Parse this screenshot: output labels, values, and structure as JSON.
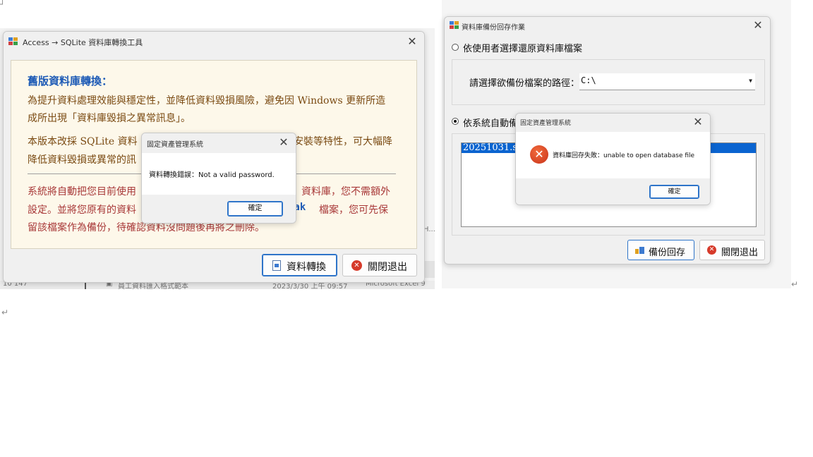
{
  "left_window": {
    "title": "Access → SQLite 資料庫轉換工具",
    "heading": "舊版資料庫轉換：",
    "para1_line1": "為提升資料處理效能與穩定性，並降低資料毀損風險，避免因 Windows 更新所造",
    "para1_line2": "成所出現「資料庫毀損之異常訊息」。",
    "para2_line1_a": "本版本改採 SQLite 資料",
    "para2_line1_b": "安裝等特性，可大幅降",
    "para2_line2": "降低資料毀損或異常的訊",
    "red_line1_a": "系統將自動把您目前使用",
    "red_line1_b": "資料庫，您不需額外",
    "red_line2_a": "設定。並將您原有的資料",
    "red_line2_b": "bak",
    "red_line2_c": "檔案，您可先保",
    "red_line3": "留該檔案作為備份，待確認資料沒問題後再將之刪除。",
    "convert_button": "資料轉換",
    "exit_button": "關閉退出"
  },
  "left_message": {
    "title": "固定資產管理系統",
    "text": "資料轉換錯誤：Not a valid password.",
    "ok": "確定"
  },
  "right_window": {
    "title": "資料庫備份回存作業",
    "radio_user": "依使用者選擇還原資料庫檔案",
    "path_label": "請選擇欲備份檔案的路徑：",
    "path_value": "C:\\",
    "radio_auto": "依系統自動備",
    "list_selected": "20251031.sdl",
    "restore_button": "備份回存",
    "exit_button": "關閉退出"
  },
  "right_message": {
    "title": "固定資產管理系統",
    "text": "資料庫回存失敗：unable to open database file",
    "ok": "確定"
  },
  "background_strip": {
    "c1": "10 147",
    "c2": "員工資料匯入格式範本",
    "c3": "2023/3/30 上午 09:57",
    "c4": "Microsoft Excel 9",
    "side_text": "H..."
  },
  "marks": {
    "return_mark": "↵"
  },
  "colors": {
    "accent_blue": "#2e74c9",
    "heading_blue": "#1e5bb6",
    "body_brown": "#7a4a12",
    "warning_red": "#a83838",
    "error_red": "#d63a2a",
    "selection_blue": "#0a64d0"
  }
}
